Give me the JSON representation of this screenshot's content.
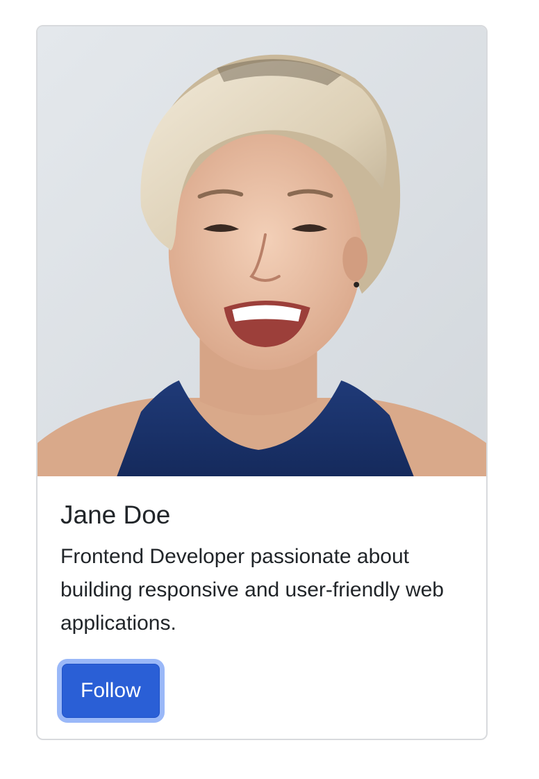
{
  "card": {
    "photo_alt": "Profile photo",
    "name": "Jane Doe",
    "bio": "Frontend Developer passionate about building responsive and user-friendly web applications.",
    "follow_label": "Follow"
  },
  "colors": {
    "accent": "#2a5fd6",
    "focus_ring": "#8fb1f5",
    "border": "#d8dadd",
    "text": "#212529"
  }
}
